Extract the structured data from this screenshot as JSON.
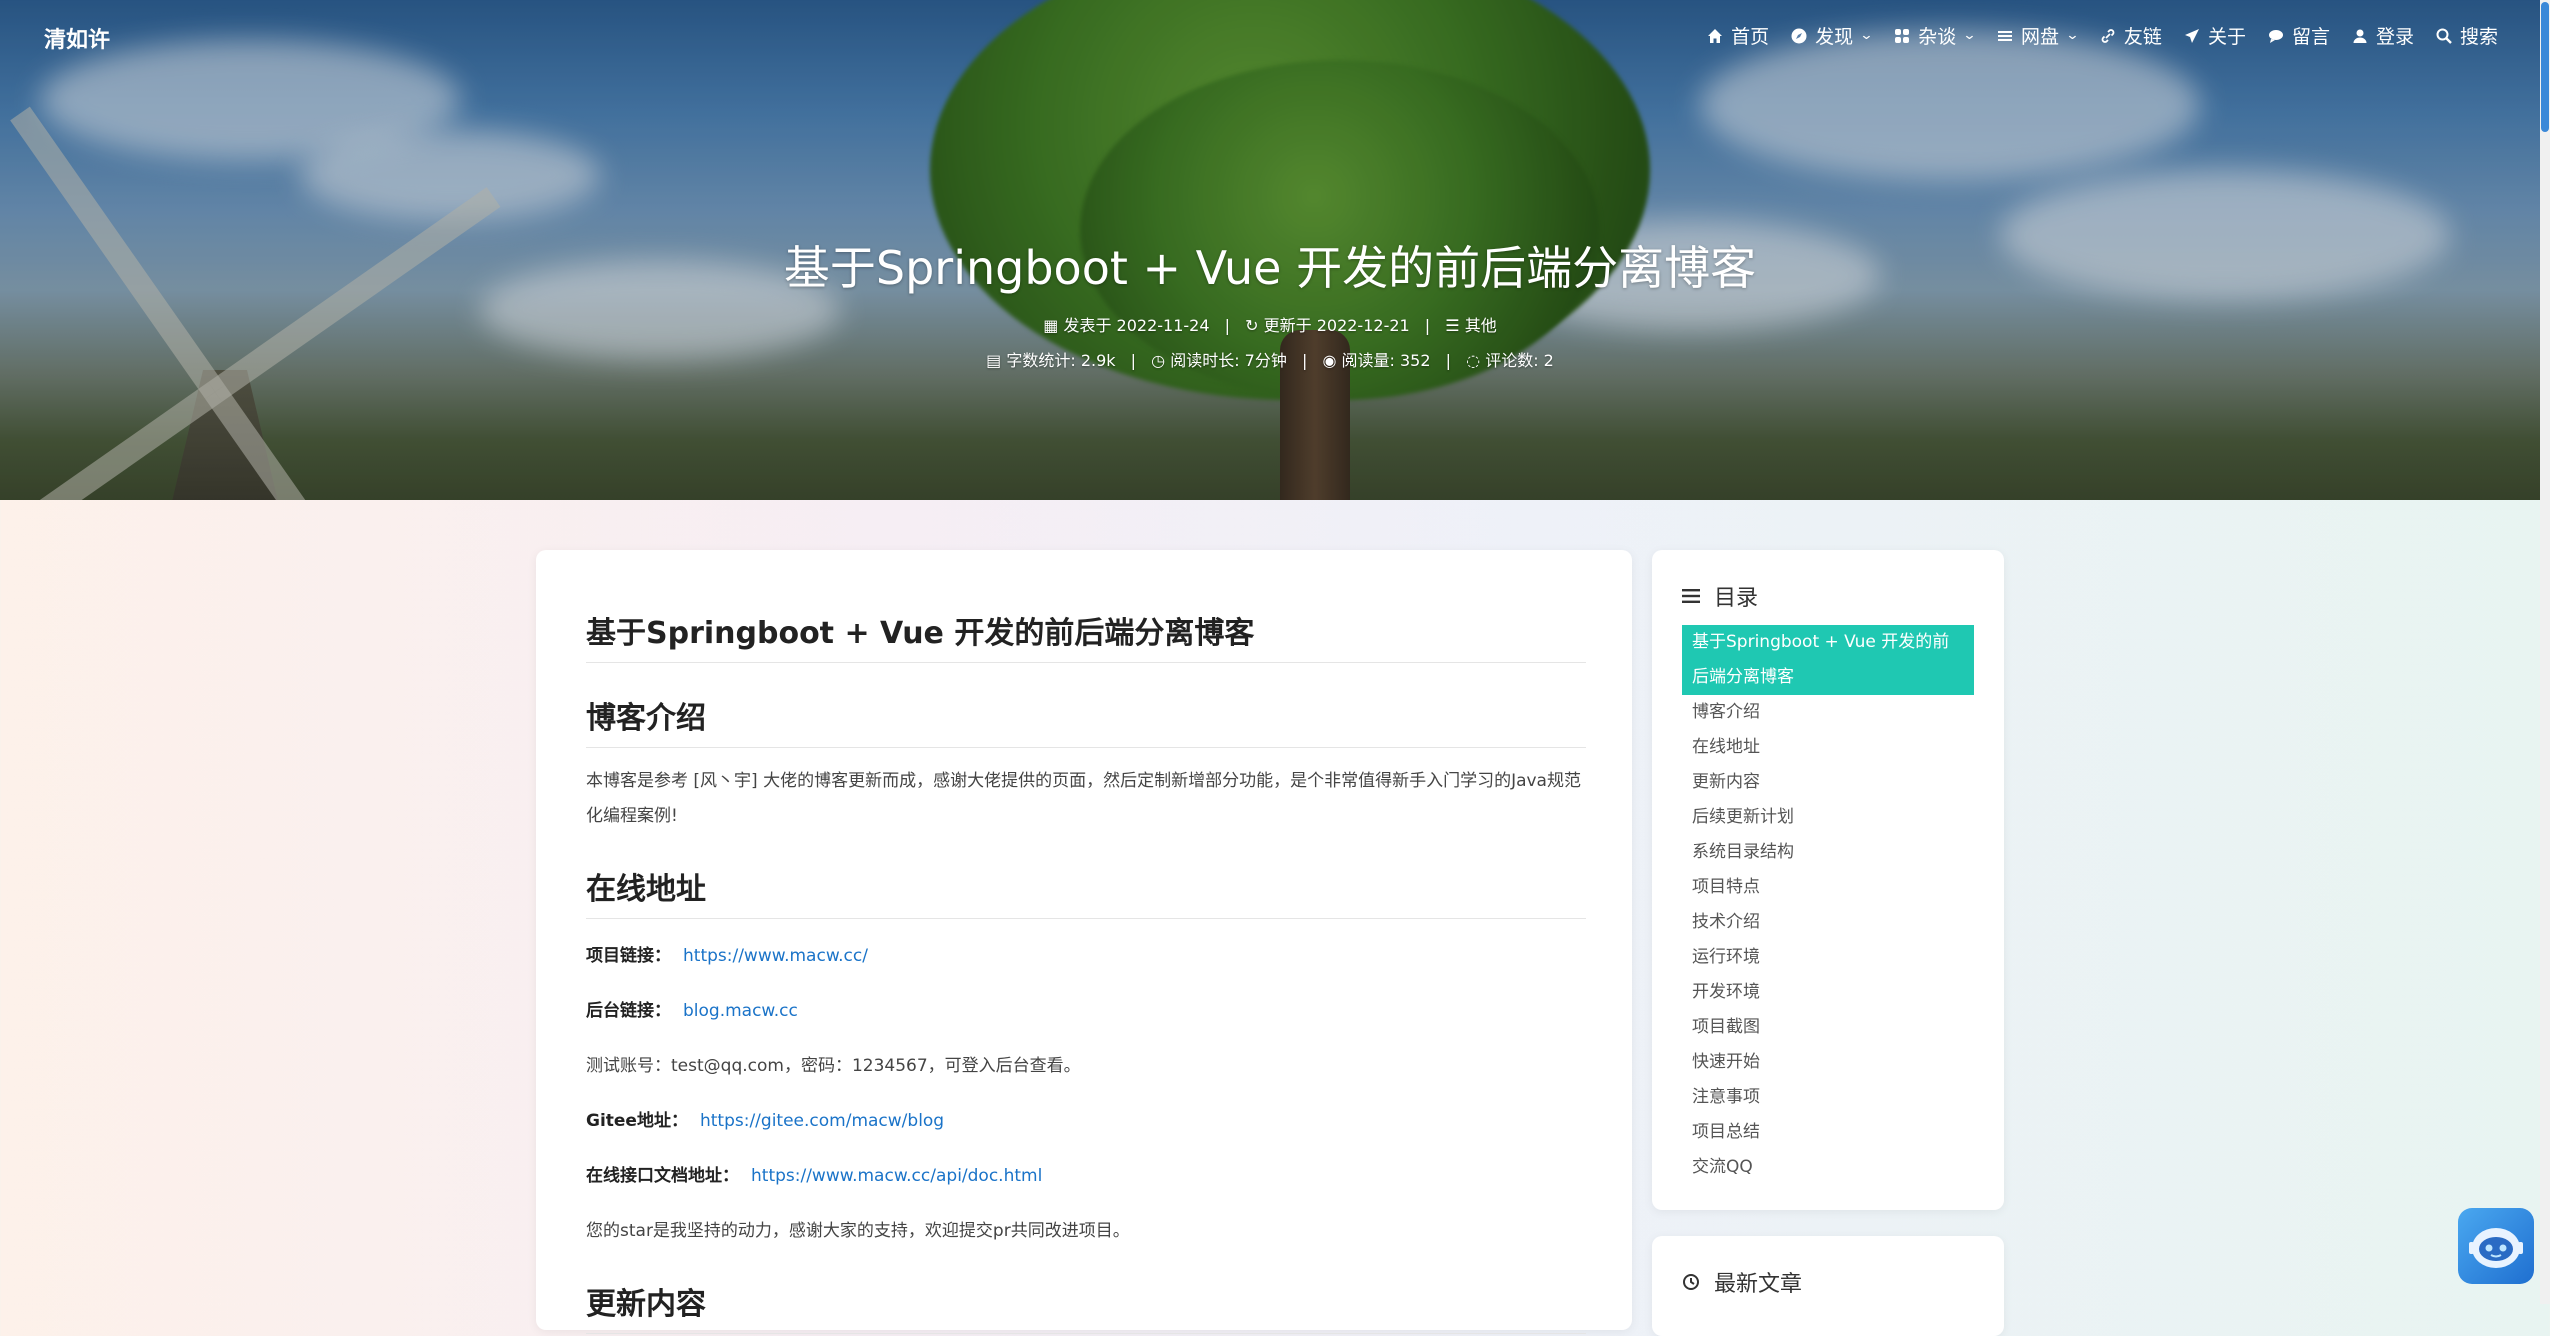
{
  "site": {
    "brand": "清如许"
  },
  "nav": [
    {
      "label": "首页",
      "icon": "home-icon",
      "dropdown": false
    },
    {
      "label": "发现",
      "icon": "compass-icon",
      "dropdown": true
    },
    {
      "label": "杂谈",
      "icon": "grid-icon",
      "dropdown": true
    },
    {
      "label": "网盘",
      "icon": "list-icon",
      "dropdown": true
    },
    {
      "label": "友链",
      "icon": "link-icon",
      "dropdown": false
    },
    {
      "label": "关于",
      "icon": "send-icon",
      "dropdown": false
    },
    {
      "label": "留言",
      "icon": "comment-icon",
      "dropdown": false
    },
    {
      "label": "登录",
      "icon": "user-icon",
      "dropdown": false
    },
    {
      "label": "搜索",
      "icon": "search-icon",
      "dropdown": false
    }
  ],
  "post": {
    "title": "基于Springboot + Vue 开发的前后端分离博客",
    "published": "发表于 2022-11-24",
    "updated": "更新于 2022-12-21",
    "category": "其他",
    "word_count": "字数统计: 2.9k",
    "read_time": "阅读时长: 7分钟",
    "views": "阅读量: 352",
    "comments": "评论数: 2"
  },
  "article": {
    "h1": "基于Springboot + Vue 开发的前后端分离博客",
    "intro_heading": "博客介绍",
    "intro_text": "本博客是参考 [风丶宇] 大佬的博客更新而成，感谢大佬提供的页面，然后定制新增部分功能，是个非常值得新手入门学习的Java规范化编程案例!",
    "online_heading": "在线地址",
    "project_link_label": "项目链接：",
    "project_link": "https://www.macw.cc/",
    "admin_link_label": "后台链接：",
    "admin_link": "blog.macw.cc",
    "test_account": "测试账号：test@qq.com，密码：1234567，可登入后台查看。",
    "gitee_label": "Gitee地址：",
    "gitee_link": "https://gitee.com/macw/blog",
    "api_label": "在线接口文档地址：",
    "api_link": "https://www.macw.cc/api/doc.html",
    "thanks": "您的star是我坚持的动力，感谢大家的支持，欢迎提交pr共同改进项目。",
    "update_heading": "更新内容"
  },
  "toc": {
    "title": "目录",
    "items": [
      "基于Springboot + Vue 开发的前后端分离博客",
      "博客介绍",
      "在线地址",
      "更新内容",
      "后续更新计划",
      "系统目录结构",
      "项目特点",
      "技术介绍",
      "运行环境",
      "开发环境",
      "项目截图",
      "快速开始",
      "注意事项",
      "项目总结",
      "交流QQ"
    ]
  },
  "recent": {
    "title": "最新文章"
  },
  "colors": {
    "accent": "#1fc8b2",
    "link": "#1a73c8"
  }
}
